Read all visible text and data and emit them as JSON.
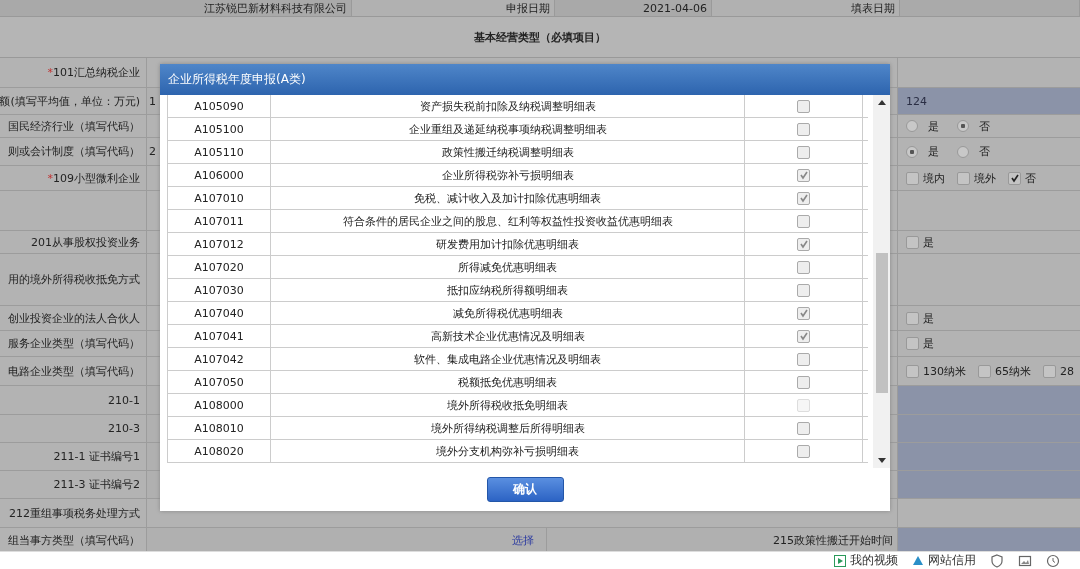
{
  "header_row": {
    "company": "江苏锐巴新材料科技有限公司",
    "date_label": "申报日期",
    "date": "2021-04-06",
    "fill_label": "填表日期"
  },
  "section_title": "基本经营类型（必填项目）",
  "form_rows": [
    {
      "label": "101汇总纳税企业",
      "marker": "*",
      "highlighted": false
    },
    {
      "label": "额(填写平均值，单位：万元)",
      "value": "1",
      "highlighted": true,
      "right": {
        "kind": "text",
        "value": "124"
      }
    },
    {
      "label": "国民经济行业（填写代码）",
      "highlighted": false,
      "right": {
        "kind": "radio",
        "options": [
          {
            "label": "是",
            "selected": false
          },
          {
            "label": "否",
            "selected": true
          }
        ]
      }
    },
    {
      "label": "则或会计制度（填写代码）",
      "value": "2",
      "highlighted": false,
      "right": {
        "kind": "radio",
        "options": [
          {
            "label": "是",
            "selected": true
          },
          {
            "label": "否",
            "selected": false
          }
        ]
      }
    },
    {
      "label": "109小型微利企业",
      "marker": "*",
      "highlighted": false,
      "right": {
        "kind": "checkbox",
        "options": [
          {
            "label": "境内",
            "checked": false
          },
          {
            "label": "境外",
            "checked": false
          },
          {
            "label": "否",
            "checked": true
          }
        ]
      }
    },
    {
      "highlighted": false
    },
    {
      "label": "201从事股权投资业务",
      "highlighted": false,
      "right": {
        "kind": "checkbox",
        "options": [
          {
            "label": "是",
            "checked": false
          }
        ]
      }
    },
    {
      "label": "用的境外所得税收抵免方式",
      "highlighted": false
    },
    {
      "label": "创业投资企业的法人合伙人",
      "highlighted": false,
      "right": {
        "kind": "checkbox",
        "options": [
          {
            "label": "是",
            "checked": false
          }
        ]
      }
    },
    {
      "label": "服务企业类型（填写代码）",
      "highlighted": false,
      "right": {
        "kind": "checkbox",
        "options": [
          {
            "label": "是",
            "checked": false
          }
        ]
      }
    },
    {
      "label": "电路企业类型（填写代码）",
      "highlighted": false,
      "right": {
        "kind": "checkbox",
        "options": [
          {
            "label": "130纳米",
            "checked": false
          },
          {
            "label": "65纳米",
            "checked": false
          },
          {
            "label": "28",
            "checked": false
          }
        ]
      }
    },
    {
      "label": "210-1",
      "highlighted": true
    },
    {
      "label": "210-3",
      "highlighted": true
    },
    {
      "label": "211-1 证书编号1",
      "highlighted": true
    },
    {
      "label": "211-3 证书编号2",
      "highlighted": true
    },
    {
      "label": "212重组事项税务处理方式",
      "highlighted": false
    },
    {
      "label": "组当事方类型（填写代码）",
      "highlighted": true,
      "link": "选择",
      "label_2": "215政策性搬迁开始时间"
    }
  ],
  "dialog": {
    "title": "企业所得税年度申报(A类)",
    "confirm": "确认",
    "rows": [
      {
        "code": "A105090",
        "name": "资产损失税前扣除及纳税调整明细表",
        "checked": false,
        "disabled": false
      },
      {
        "code": "A105100",
        "name": "企业重组及递延纳税事项纳税调整明细表",
        "checked": false,
        "disabled": false
      },
      {
        "code": "A105110",
        "name": "政策性搬迁纳税调整明细表",
        "checked": false,
        "disabled": false
      },
      {
        "code": "A106000",
        "name": "企业所得税弥补亏损明细表",
        "checked": true,
        "disabled": false
      },
      {
        "code": "A107010",
        "name": "免税、减计收入及加计扣除优惠明细表",
        "checked": true,
        "disabled": false
      },
      {
        "code": "A107011",
        "name": "符合条件的居民企业之间的股息、红利等权益性投资收益优惠明细表",
        "checked": false,
        "disabled": false
      },
      {
        "code": "A107012",
        "name": "研发费用加计扣除优惠明细表",
        "checked": true,
        "disabled": false
      },
      {
        "code": "A107020",
        "name": "所得减免优惠明细表",
        "checked": false,
        "disabled": false
      },
      {
        "code": "A107030",
        "name": "抵扣应纳税所得额明细表",
        "checked": false,
        "disabled": false
      },
      {
        "code": "A107040",
        "name": "减免所得税优惠明细表",
        "checked": true,
        "disabled": false
      },
      {
        "code": "A107041",
        "name": "高新技术企业优惠情况及明细表",
        "checked": true,
        "disabled": false
      },
      {
        "code": "A107042",
        "name": "软件、集成电路企业优惠情况及明细表",
        "checked": false,
        "disabled": false
      },
      {
        "code": "A107050",
        "name": "税额抵免优惠明细表",
        "checked": false,
        "disabled": false
      },
      {
        "code": "A108000",
        "name": "境外所得税收抵免明细表",
        "checked": false,
        "disabled": true
      },
      {
        "code": "A108010",
        "name": "境外所得纳税调整后所得明细表",
        "checked": false,
        "disabled": false
      },
      {
        "code": "A108020",
        "name": "境外分支机构弥补亏损明细表",
        "checked": false,
        "disabled": false
      }
    ]
  },
  "status_bar": {
    "items": [
      "我的视频",
      "网站信用"
    ]
  }
}
